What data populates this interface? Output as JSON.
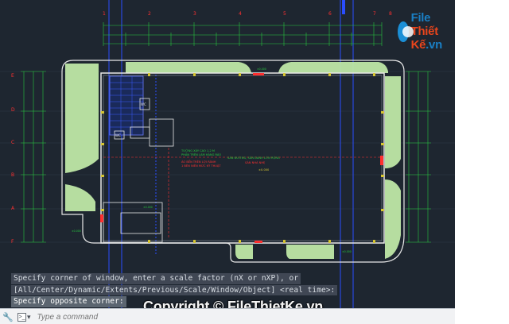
{
  "logo": {
    "text_part1": "File ",
    "text_part2": "Thiết Kế",
    "text_part3": ".vn"
  },
  "command_history": [
    "Specify corner of window, enter a scale factor (nX or nXP), or",
    "[All/Center/Dynamic/Extents/Previous/Scale/Window/Object] <real time>:",
    "Specify opposite corner:"
  ],
  "command_line": {
    "placeholder": "Type a command",
    "wrench_icon": "wrench-icon",
    "prompt_icon": "prompt-options-icon"
  },
  "watermark": "Copyright © FileThietKe.vn",
  "colors": {
    "model_background": "#1e2630",
    "wall": "#e8e8e8",
    "planting": "#bfe7a6",
    "dimension_green": "#27c93f",
    "grid_red": "#ff3030",
    "axis_blue": "#2a4dff",
    "column_yellow": "#d6c532",
    "accent_blue": "#1a7fc4"
  },
  "grid_labels": {
    "top": [
      "1",
      "2",
      "3",
      "4",
      "5",
      "6",
      "7",
      "8"
    ],
    "left": [
      "E",
      "D",
      "C",
      "B",
      "A",
      "F"
    ]
  },
  "room_labels": [
    "ĐÈN",
    "TƯỜNG",
    "SHOP"
  ],
  "notes": [
    "TƯỜNG XÂY CAO 1,2 M",
    "SÀN ĐƯỜNG, SÂN DANH..."
  ]
}
